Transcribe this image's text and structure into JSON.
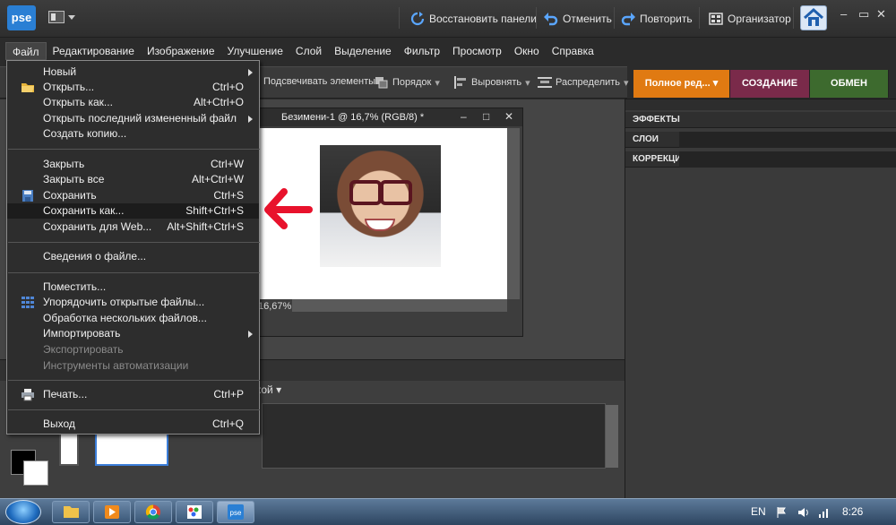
{
  "app": {
    "logo_text": "pse"
  },
  "toolbar": {
    "restore_panels": "Восстановить панели",
    "undo": "Отменить",
    "redo": "Повторить",
    "organizer": "Организатор"
  },
  "menubar": {
    "items": [
      "Файл",
      "Редактирование",
      "Изображение",
      "Улучшение",
      "Слой",
      "Выделение",
      "Фильтр",
      "Просмотр",
      "Окно",
      "Справка"
    ],
    "active": "Файл"
  },
  "options_bar": {
    "highlight_elements": "Подсвечивать элементы",
    "order": "Порядок",
    "align": "Выровнять",
    "distribute": "Распределить"
  },
  "mode_tabs": [
    {
      "label": "Полное ред...",
      "color": "#e07a12"
    },
    {
      "label": "СОЗДАНИЕ",
      "color": "#7a2a4a"
    },
    {
      "label": "ОБМЕН",
      "color": "#3d6a2e"
    }
  ],
  "document": {
    "title": "Безимени-1 @ 16,7% (RGB/8) *",
    "zoom": "16,67%"
  },
  "panels": [
    "ЭФФЕКТЫ",
    "СЛОИ",
    "КОРРЕКЦИЯ"
  ],
  "bin": {
    "dropdown_fragment": "кой"
  },
  "file_menu": {
    "items": [
      {
        "label": "Новый",
        "shortcut": "",
        "submenu": true
      },
      {
        "label": "Открыть...",
        "shortcut": "Ctrl+O",
        "icon": "folder-icon"
      },
      {
        "label": "Открыть как...",
        "shortcut": "Alt+Ctrl+O"
      },
      {
        "label": "Открыть последний измененный файл",
        "shortcut": "",
        "submenu": true
      },
      {
        "label": "Создать копию...",
        "shortcut": ""
      },
      {
        "label": "Закрыть",
        "shortcut": "Ctrl+W"
      },
      {
        "label": "Закрыть все",
        "shortcut": "Alt+Ctrl+W"
      },
      {
        "label": "Сохранить",
        "shortcut": "Ctrl+S",
        "icon": "save-icon"
      },
      {
        "label": "Сохранить как...",
        "shortcut": "Shift+Ctrl+S",
        "highlighted": true
      },
      {
        "label": "Сохранить для Web...",
        "shortcut": "Alt+Shift+Ctrl+S"
      },
      {
        "label": "Сведения о файле...",
        "shortcut": ""
      },
      {
        "label": "Поместить...",
        "shortcut": ""
      },
      {
        "label": "Упорядочить открытые файлы...",
        "shortcut": "",
        "icon": "grid-icon"
      },
      {
        "label": "Обработка нескольких файлов...",
        "shortcut": ""
      },
      {
        "label": "Импортировать",
        "shortcut": "",
        "submenu": true
      },
      {
        "label": "Экспортировать",
        "shortcut": "",
        "disabled": true
      },
      {
        "label": "Инструменты автоматизации",
        "shortcut": "",
        "disabled": true
      },
      {
        "label": "Печать...",
        "shortcut": "Ctrl+P",
        "icon": "printer-icon"
      },
      {
        "label": "Выход",
        "shortcut": "Ctrl+Q"
      }
    ]
  },
  "taskbar": {
    "language": "EN",
    "time": "8:26"
  }
}
